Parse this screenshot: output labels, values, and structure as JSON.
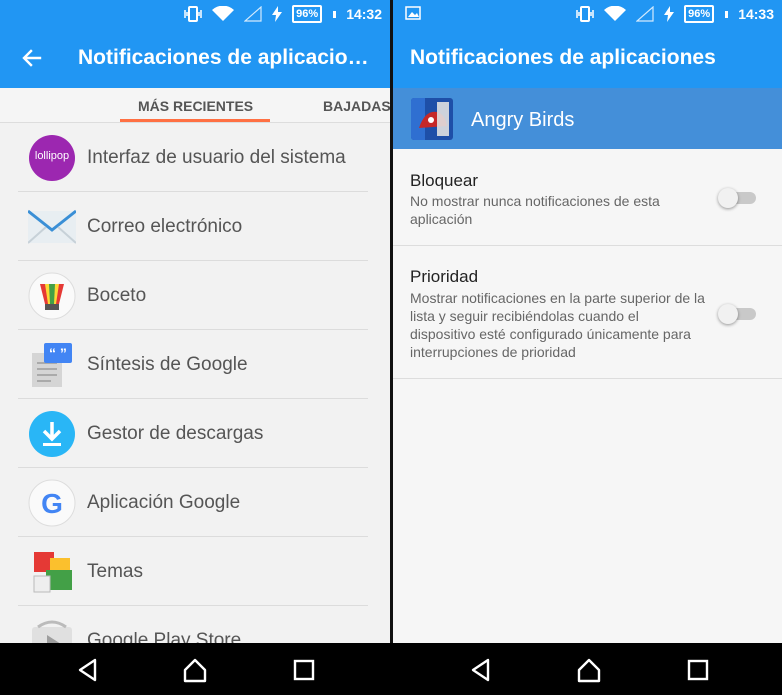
{
  "left": {
    "status": {
      "battery": "96%",
      "time": "14:32"
    },
    "appbar": {
      "title": "Notificaciones de aplicacio…"
    },
    "tabs": [
      {
        "label": "MÁS RECIENTES"
      },
      {
        "label": "BAJADAS"
      }
    ],
    "apps": [
      {
        "label": "Interfaz de usuario del sistema",
        "icon_text": "lollipop"
      },
      {
        "label": "Correo electrónico"
      },
      {
        "label": "Boceto"
      },
      {
        "label": "Síntesis de Google",
        "icon_text": "“ ”"
      },
      {
        "label": "Gestor de descargas"
      },
      {
        "label": "Aplicación Google",
        "icon_text": "G"
      },
      {
        "label": "Temas"
      },
      {
        "label": "Google Play Store"
      }
    ]
  },
  "right": {
    "status": {
      "battery": "96%",
      "time": "14:33"
    },
    "appbar": {
      "title": "Notificaciones de aplicaciones"
    },
    "app": {
      "name": "Angry Birds"
    },
    "settings": [
      {
        "title": "Bloquear",
        "description": "No mostrar nunca notificaciones de esta aplicación",
        "enabled": false
      },
      {
        "title": "Prioridad",
        "description": "Mostrar notificaciones en la parte superior de la lista y seguir recibiéndolas cuando el dispositivo esté configurado únicamente para interrupciones de prioridad",
        "enabled": false
      }
    ]
  },
  "colors": {
    "primary": "#2196f3",
    "tab_indicator": "#ff7043",
    "app_header": "#448fd9"
  }
}
